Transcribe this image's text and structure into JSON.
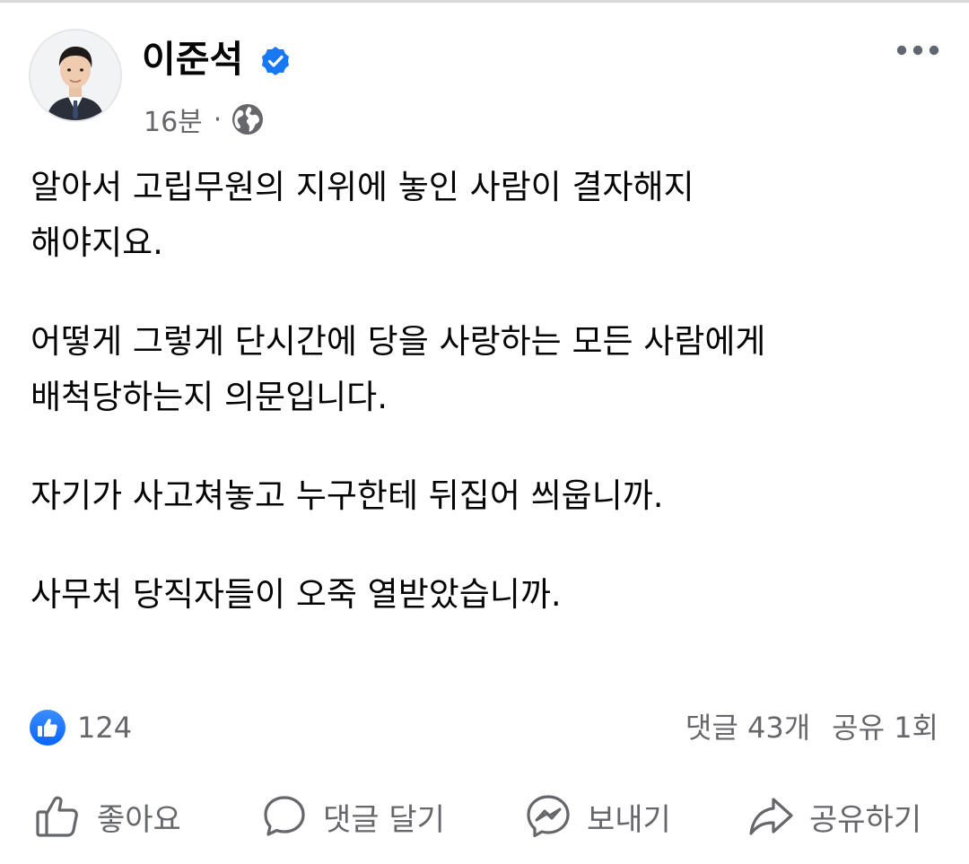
{
  "post": {
    "author": "이준석",
    "timestamp": "16분",
    "separator": "·",
    "paragraphs": [
      {
        "lines": [
          "알아서 고립무원의 지위에 놓인 사람이 결자해지",
          "해야지요."
        ]
      },
      {
        "lines": [
          "어떻게 그렇게 단시간에 당을 사랑하는 모든 사람에게",
          "배척당하는지 의문입니다."
        ]
      },
      {
        "lines": [
          "자기가 사고쳐놓고 누구한테 뒤집어 씌웁니까."
        ]
      },
      {
        "lines": [
          "사무처 당직자들이 오죽 열받았습니까."
        ]
      }
    ]
  },
  "reactions": {
    "like_count": "124",
    "comments": "댓글 43개",
    "shares": "공유 1회"
  },
  "actions": {
    "like": "좋아요",
    "comment": "댓글 달기",
    "send": "보내기",
    "share": "공유하기"
  },
  "colors": {
    "accent": "#1877f2",
    "secondary_text": "#65676b",
    "primary_text": "#050505"
  },
  "icons": [
    "verified-icon",
    "globe-icon",
    "more-icon",
    "like-badge-icon",
    "thumbs-up-icon",
    "comment-bubble-icon",
    "messenger-icon",
    "share-arrow-icon"
  ]
}
